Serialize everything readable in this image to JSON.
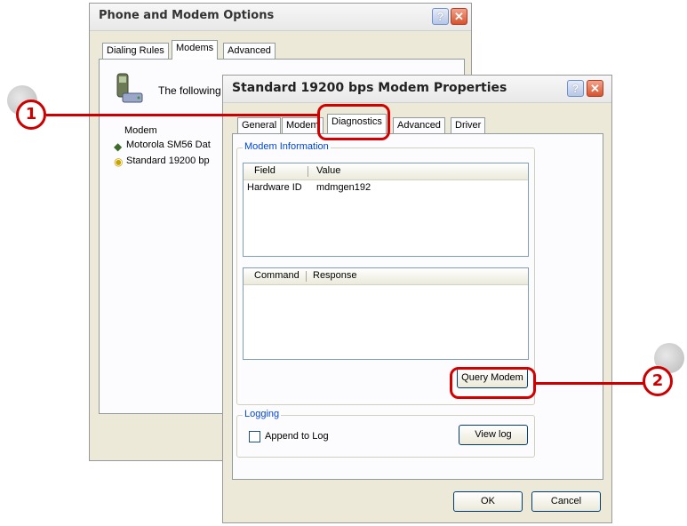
{
  "back_window": {
    "title": "Phone and Modem Options",
    "tabs": [
      "Dialing Rules",
      "Modems",
      "Advanced"
    ],
    "selected_tab": "Modems",
    "intro_text": "The following",
    "list_header": "Modem",
    "modems": [
      "Motorola SM56 Dat",
      "Standard 19200 bp"
    ]
  },
  "front_window": {
    "title": "Standard 19200 bps Modem Properties",
    "help_glyph": "?",
    "close_glyph": "✕",
    "tabs": [
      "General",
      "Modem",
      "Diagnostics",
      "Advanced",
      "Driver"
    ],
    "selected_tab": "Diagnostics",
    "modem_info": {
      "label": "Modem Information",
      "columns": [
        "Field",
        "Value"
      ],
      "rows": [
        {
          "field": "Hardware ID",
          "value": "mdmgen192"
        }
      ],
      "command_columns": [
        "Command",
        "Response"
      ],
      "query_button": "Query Modem"
    },
    "logging": {
      "label": "Logging",
      "append_label": "Append to Log",
      "append_checked": false,
      "view_log_button": "View log"
    },
    "ok_button": "OK",
    "cancel_button": "Cancel"
  },
  "callouts": [
    {
      "number": "1",
      "target": "Diagnostics tab"
    },
    {
      "number": "2",
      "target": "Query Modem button"
    }
  ],
  "colors": {
    "callout": "#cc0000",
    "group_label": "#0046d5"
  }
}
